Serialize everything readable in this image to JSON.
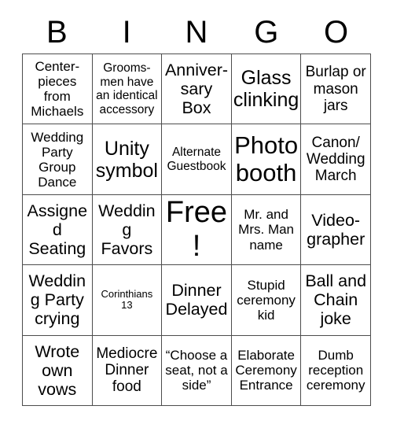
{
  "card": {
    "header_letters": [
      "B",
      "I",
      "N",
      "G",
      "O"
    ],
    "rows": [
      [
        {
          "text": "Center-pieces from Michaels",
          "size": "fs-16"
        },
        {
          "text": "Grooms-men have an identical accessory",
          "size": "fs-14"
        },
        {
          "text": "Anniver-sary Box",
          "size": "fs-21"
        },
        {
          "text": "Glass clinking",
          "size": "fs-25"
        },
        {
          "text": "Burlap or mason jars",
          "size": "fs-18"
        }
      ],
      [
        {
          "text": "Wedding Party Group Dance",
          "size": "fs-16"
        },
        {
          "text": "Unity symbol",
          "size": "fs-25"
        },
        {
          "text": "Alternate Guestbook",
          "size": "fs-14"
        },
        {
          "text": "Photo booth",
          "size": "fs-30"
        },
        {
          "text": "Canon/ Wedding March",
          "size": "fs-18"
        }
      ],
      [
        {
          "text": "Assigned Seating",
          "size": "fs-21"
        },
        {
          "text": "Wedding Favors",
          "size": "fs-21"
        },
        {
          "text": "Free!",
          "size": "fs-38"
        },
        {
          "text": "Mr. and Mrs. Man name",
          "size": "fs-16"
        },
        {
          "text": "Video-grapher",
          "size": "fs-21"
        }
      ],
      [
        {
          "text": "Wedding Party crying",
          "size": "fs-21"
        },
        {
          "text": "Corinthians 13",
          "size": "fs-11"
        },
        {
          "text": "Dinner Delayed",
          "size": "fs-21"
        },
        {
          "text": "Stupid ceremony kid",
          "size": "fs-16"
        },
        {
          "text": "Ball and Chain joke",
          "size": "fs-21"
        }
      ],
      [
        {
          "text": "Wrote own vows",
          "size": "fs-21"
        },
        {
          "text": "Mediocre Dinner food",
          "size": "fs-18"
        },
        {
          "text": "“Choose a seat, not a side”",
          "size": "fs-16"
        },
        {
          "text": "Elaborate Ceremony Entrance",
          "size": "fs-16"
        },
        {
          "text": "Dumb reception ceremony",
          "size": "fs-16"
        }
      ]
    ]
  }
}
